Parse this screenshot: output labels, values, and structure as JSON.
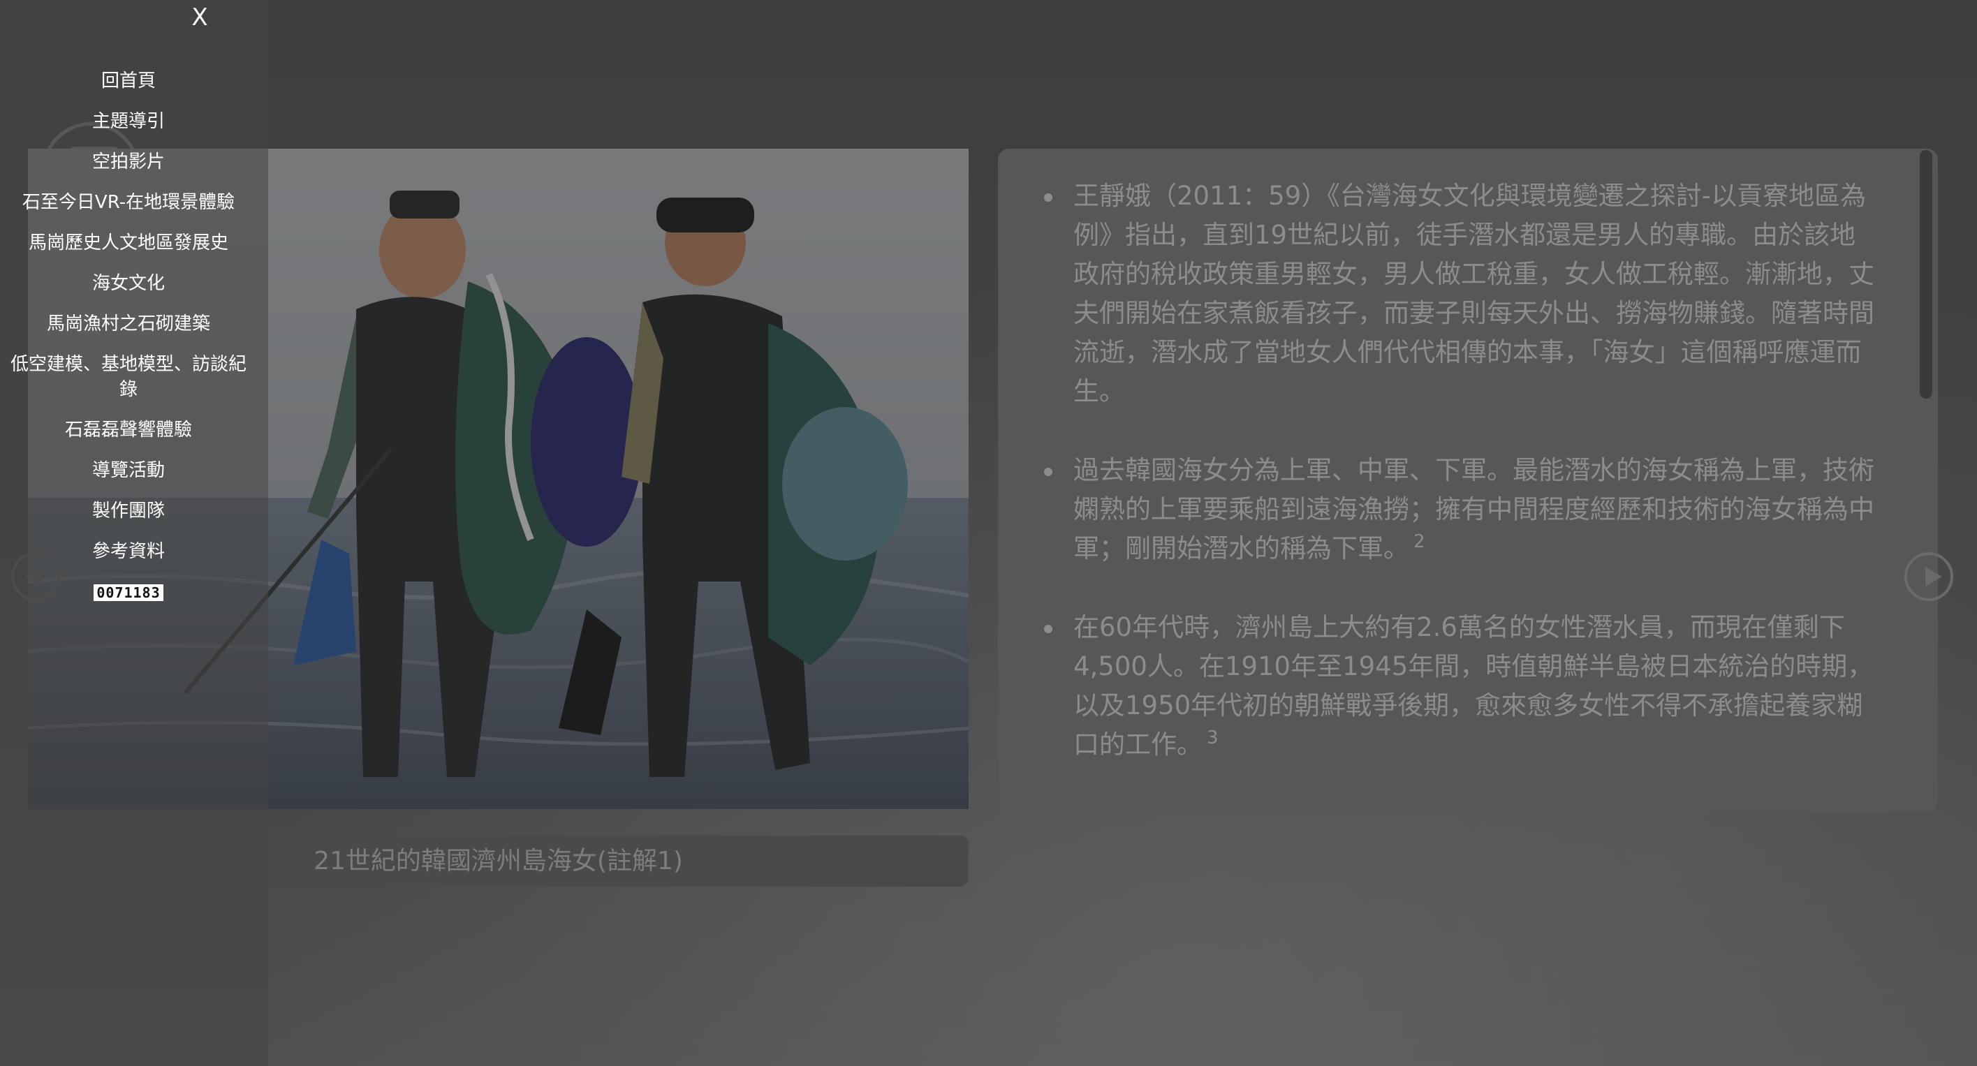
{
  "menu": {
    "close_label": "X",
    "items": [
      {
        "label": "回首頁"
      },
      {
        "label": "主題導引"
      },
      {
        "label": "空拍影片"
      },
      {
        "label": "石至今日VR-在地環景體驗"
      },
      {
        "label": "馬崗歷史人文地區發展史"
      },
      {
        "label": "海女文化"
      },
      {
        "label": "馬崗漁村之石砌建築"
      },
      {
        "label": "低空建模、基地模型、訪談紀錄"
      },
      {
        "label": "石磊磊聲響體驗"
      },
      {
        "label": "導覽活動"
      },
      {
        "label": "製作團隊"
      },
      {
        "label": "參考資料"
      }
    ],
    "visitor_counter": "0071183"
  },
  "photo": {
    "subject": "two haenyeo divers walking in shallow sea carrying nets"
  },
  "caption": "21世紀的韓國濟州島海女(註解1)",
  "paragraphs": [
    {
      "text": "王靜娥（2011：59）《台灣海女文化與環境變遷之探討-以貢寮地區為例》指出，直到19世紀以前，徒手潛水都還是男人的專職。由於該地政府的稅收政策重男輕女，男人做工稅重，女人做工稅輕。漸漸地，丈夫們開始在家煮飯看孩子，而妻子則每天外出、撈海物賺錢。隨著時間流逝，潛水成了當地女人們代代相傳的本事，「海女」這個稱呼應運而生。",
      "note": ""
    },
    {
      "text": "過去韓國海女分為上軍、中軍、下軍。最能潛水的海女稱為上軍，技術嫻熟的上軍要乘船到遠海漁撈；擁有中間程度經歷和技術的海女稱為中軍；剛開始潛水的稱為下軍。",
      "note": "2"
    },
    {
      "text": "在60年代時，濟州島上大約有2.6萬名的女性潛水員，而現在僅剩下4,500人。在1910年至1945年間，時值朝鮮半島被日本統治的時期，以及1950年代初的朝鮮戰爭後期，愈來愈多女性不得不承擔起養家糊口的工作。",
      "note": "3"
    }
  ],
  "icons": {
    "prev": "chevron-left-circle-icon",
    "next": "play-circle-icon",
    "logo": "site-logo-icon"
  }
}
